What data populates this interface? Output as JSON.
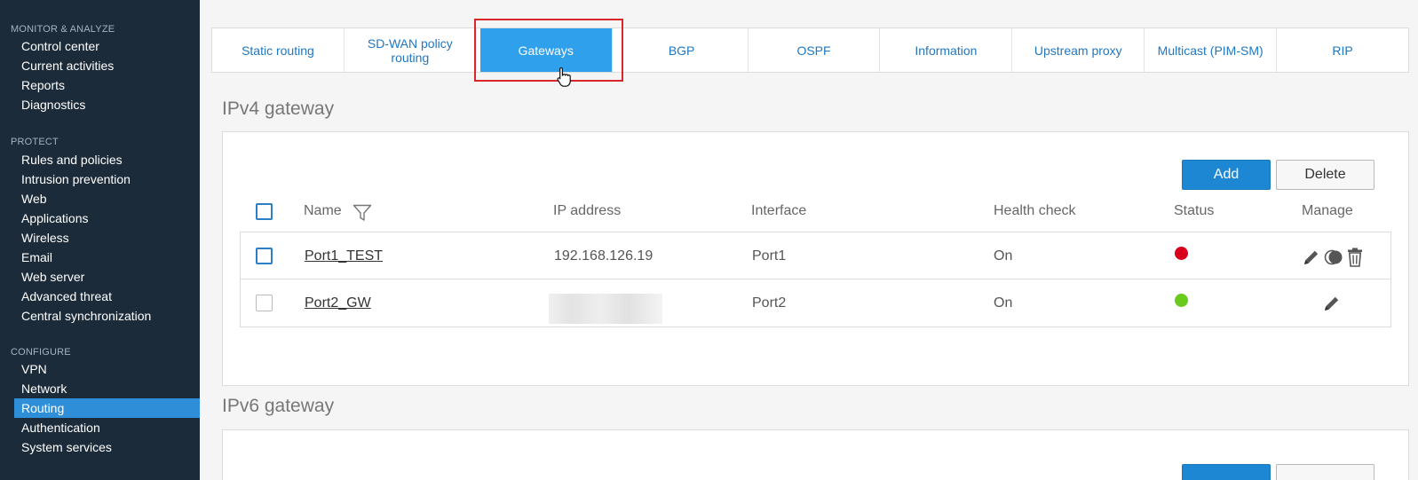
{
  "sidebar": {
    "sections": [
      {
        "title": "MONITOR & ANALYZE",
        "items": [
          "Control center",
          "Current activities",
          "Reports",
          "Diagnostics"
        ]
      },
      {
        "title": "PROTECT",
        "items": [
          "Rules and policies",
          "Intrusion prevention",
          "Web",
          "Applications",
          "Wireless",
          "Email",
          "Web server",
          "Advanced threat",
          "Central synchronization"
        ]
      },
      {
        "title": "CONFIGURE",
        "items": [
          "VPN",
          "Network",
          "Routing",
          "Authentication",
          "System services"
        ]
      }
    ],
    "active_item": "Routing"
  },
  "tabs": [
    {
      "label": "Static routing"
    },
    {
      "label": "SD-WAN policy routing"
    },
    {
      "label": "Gateways",
      "active": true
    },
    {
      "label": "BGP"
    },
    {
      "label": "OSPF"
    },
    {
      "label": "Information"
    },
    {
      "label": "Upstream proxy"
    },
    {
      "label": "Multicast (PIM-SM)"
    },
    {
      "label": "RIP"
    }
  ],
  "ipv4": {
    "title": "IPv4 gateway",
    "add_label": "Add",
    "delete_label": "Delete",
    "columns": [
      "Name",
      "IP address",
      "Interface",
      "Health check",
      "Status",
      "Manage"
    ],
    "rows": [
      {
        "name": "Port1_TEST",
        "ip": "192.168.126.19",
        "interface": "Port1",
        "health": "On",
        "status": "down",
        "status_color": "#d9001b",
        "manage": [
          "edit-icon",
          "toggle-icon",
          "delete-icon"
        ]
      },
      {
        "name": "Port2_GW",
        "ip": "",
        "interface": "Port2",
        "health": "On",
        "status": "up",
        "status_color": "#6acb1e",
        "manage": [
          "edit-icon"
        ]
      }
    ]
  },
  "ipv6": {
    "title": "IPv6 gateway"
  },
  "colors": {
    "sidebar_bg": "#1c2b39",
    "accent": "#1e87d4",
    "active_tab": "#2ea0ec",
    "highlight": "#d8262b"
  }
}
